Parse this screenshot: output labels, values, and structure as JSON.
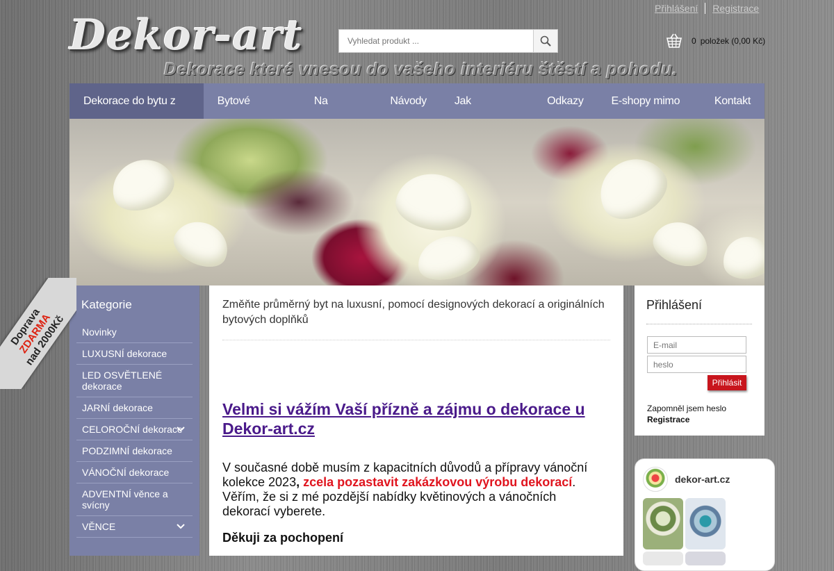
{
  "header": {
    "links": {
      "login": "Přihlášení",
      "register": "Registrace"
    },
    "logo": "Dekor-art",
    "slogan": "Dekorace které vnesou do vašeho interiéru štěstí a pohodu.",
    "search": {
      "placeholder": "Vyhledat produkt ..."
    },
    "cart": {
      "count": "0",
      "label": "položek (0,00 Kč)"
    }
  },
  "nav": [
    {
      "label": "Dekorace do bytu z květin",
      "active": true
    },
    {
      "label": "Bytové dekorace"
    },
    {
      "label": "Na zakázku"
    },
    {
      "label": "Návody"
    },
    {
      "label": "Jak nakupovat?"
    },
    {
      "label": "Odkazy"
    },
    {
      "label": "E-shopy mimo ČR"
    },
    {
      "label": "Kontakt"
    }
  ],
  "badge": {
    "line1": "Doprava",
    "line2": "ZDARMA",
    "line3": "nad 2000Kč"
  },
  "sidebar": {
    "title": "Kategorie",
    "items": [
      {
        "label": "Novinky"
      },
      {
        "label": "LUXUSNÍ dekorace"
      },
      {
        "label": "LED OSVĚTLENÉ dekorace"
      },
      {
        "label": "JARNÍ dekorace"
      },
      {
        "label": "CELOROČNÍ dekorace",
        "has_submenu": true
      },
      {
        "label": "PODZIMNÍ dekorace"
      },
      {
        "label": "VÁNOČNÍ dekorace"
      },
      {
        "label": "ADVENTNÍ věnce a svícny"
      },
      {
        "label": "VĚNCE",
        "has_submenu": true
      }
    ]
  },
  "main": {
    "title": "Změňte průměrný byt na luxusní, pomocí designových dekorací a originálních bytových doplňků",
    "headline": "Velmi si vážím Vaší přízně a zájmu o dekorace u Dekor-art.cz",
    "para_a": "V současné době musím z kapacitních důvodů a přípravy vánoční kolekce 2023",
    "para_b": ", ",
    "para_red": "zcela pozastavit zakázkovou výrobu dekorací",
    "para_c": ". Věřím, že si z mé pozdější nabídky květinových a vánočních dekorací vyberete.",
    "thanks": "Děkuji za pochopení"
  },
  "login": {
    "title": "Přihlášení",
    "email_placeholder": "E-mail",
    "password_placeholder": "heslo",
    "submit": "Přihlásit",
    "forgot": "Zapomněl jsem heslo",
    "register": "Registrace"
  },
  "instagram": {
    "handle": "dekor-art.cz"
  },
  "colors": {
    "nav": "#7a80a6",
    "nav_active": "#5f648a",
    "link": "#4a1a8a",
    "alert": "#e0151f",
    "button": "#c8151d"
  }
}
